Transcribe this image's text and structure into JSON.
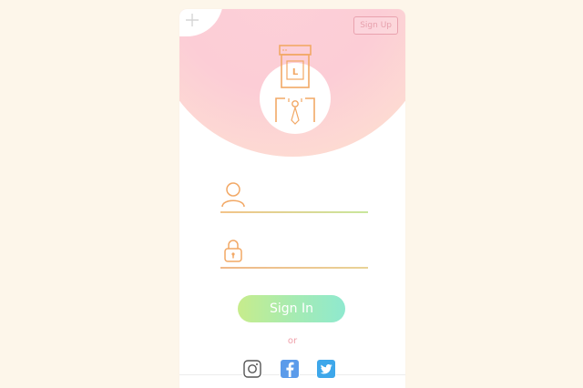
{
  "header": {
    "signup_label": "Sign Up"
  },
  "logo": {
    "letter": "L"
  },
  "form": {
    "username_icon": "user-icon",
    "password_icon": "lock-icon",
    "username_placeholder": "",
    "password_placeholder": ""
  },
  "actions": {
    "signin_label": "Sign In",
    "or_label": "or"
  },
  "social": [
    {
      "name": "instagram-icon"
    },
    {
      "name": "facebook-icon"
    },
    {
      "name": "twitter-icon"
    }
  ],
  "colors": {
    "background": "#fdf6ea",
    "accent_orange": "#f2a865",
    "accent_pink": "#e9a2ae",
    "signin_gradient_start": "#c7ec8c",
    "signin_gradient_end": "#8fe9cf",
    "facebook_blue": "#5b9bea",
    "twitter_blue": "#3ea7ea"
  }
}
